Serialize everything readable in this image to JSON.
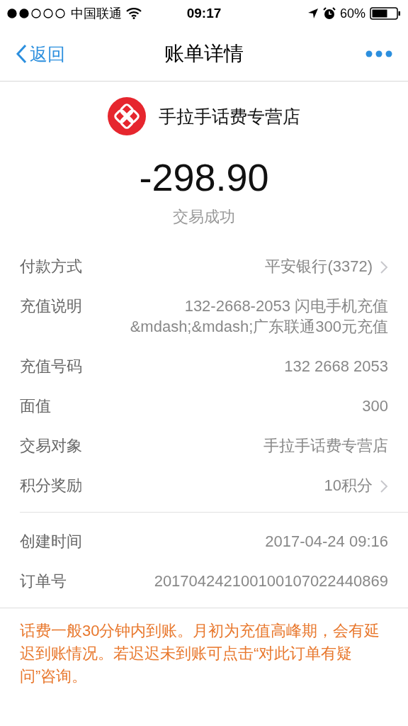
{
  "status_bar": {
    "carrier": "中国联通",
    "time": "09:17",
    "battery": "60%"
  },
  "nav": {
    "back": "返回",
    "title": "账单详情"
  },
  "merchant": {
    "name": "手拉手话费专营店"
  },
  "amount": "-298.90",
  "status": "交易成功",
  "details": [
    {
      "label": "付款方式",
      "value": "平安银行(3372)",
      "chevron": true
    },
    {
      "label": "充值说明",
      "value": "132-2668-2053 闪电手机充值&mdash;&mdash;广东联通300元充值",
      "chevron": false
    },
    {
      "label": "充值号码",
      "value": "132 2668 2053",
      "chevron": false
    },
    {
      "label": "面值",
      "value": "300",
      "chevron": false
    },
    {
      "label": "交易对象",
      "value": "手拉手话费专营店",
      "chevron": false
    },
    {
      "label": "积分奖励",
      "value": "10积分",
      "chevron": true
    }
  ],
  "order_info": [
    {
      "label": "创建时间",
      "value": "2017-04-24 09:16",
      "chevron": false
    },
    {
      "label": "订单号",
      "value": "201704242100100107022440869",
      "chevron": false
    }
  ],
  "notice": "话费一般30分钟内到账。月初为充值高峰期，会有延迟到账情况。若迟迟未到账可点击“对此订单有疑问”咨询。"
}
